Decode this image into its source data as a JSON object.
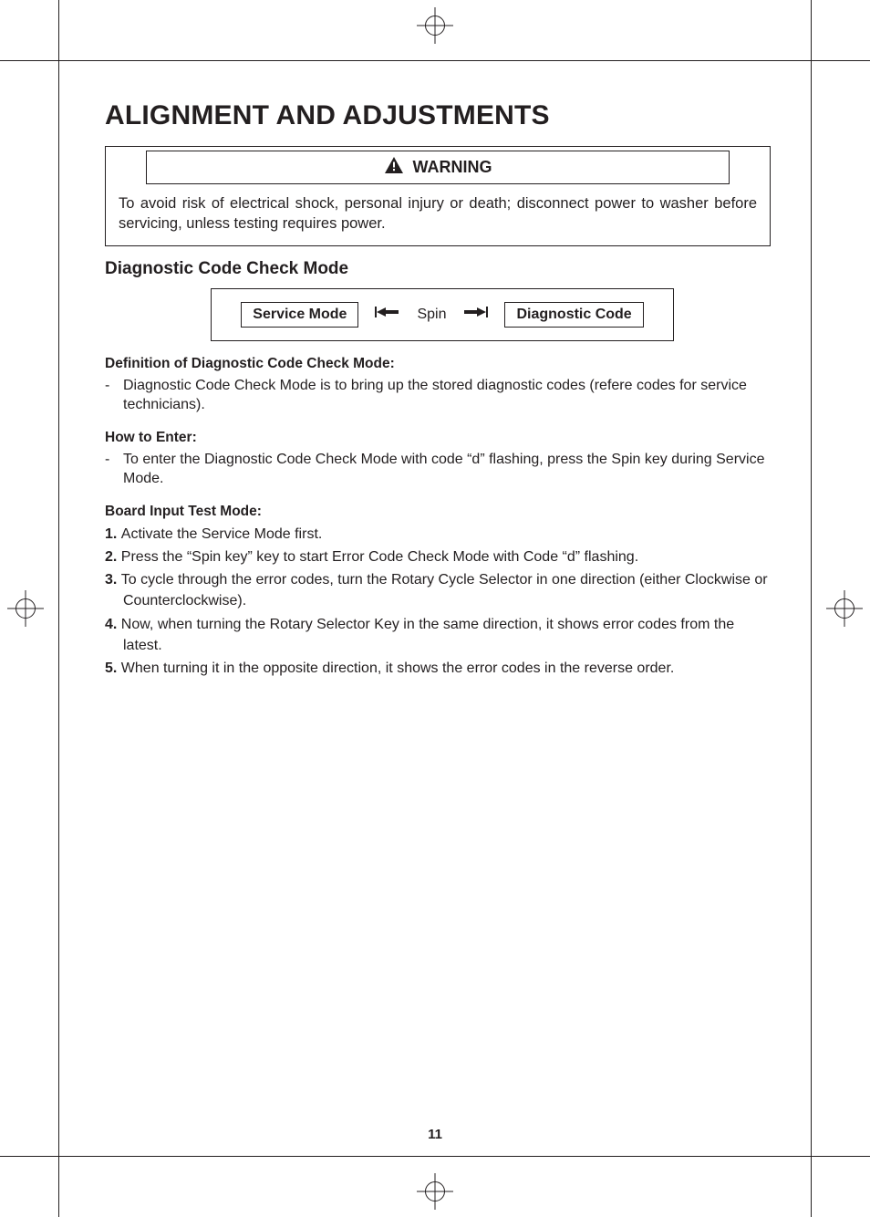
{
  "page": {
    "title": "ALIGNMENT AND ADJUSTMENTS",
    "number": "11"
  },
  "warning": {
    "label": "WARNING",
    "text": "To avoid risk of electrical shock, personal injury or death; disconnect power to washer before servicing, unless testing requires power."
  },
  "diagnostic": {
    "heading": "Diagnostic Code Check Mode",
    "flow": {
      "left": "Service Mode",
      "middle": "Spin",
      "right": "Diagnostic Code"
    },
    "definition": {
      "heading": "Definition of Diagnostic Code Check Mode:",
      "item": "Diagnostic Code Check Mode is to bring up the stored diagnostic codes (refere codes for service technicians)."
    },
    "how_to_enter": {
      "heading": "How to Enter:",
      "item": "To enter the Diagnostic Code Check Mode with code “d” flashing, press the Spin key during Service Mode."
    },
    "board_input": {
      "heading": "Board Input Test Mode:",
      "steps": [
        "Activate the Service Mode first.",
        "Press the “Spin key” key to start Error Code Check Mode with Code “d” flashing.",
        "To cycle through the error codes, turn the Rotary Cycle Selector in one direction (either Clockwise or Counterclockwise).",
        "Now, when turning the Rotary Selector Key in the same direction, it shows error codes from the latest.",
        "When turning it in the opposite direction, it shows the error codes in the reverse order."
      ]
    }
  }
}
